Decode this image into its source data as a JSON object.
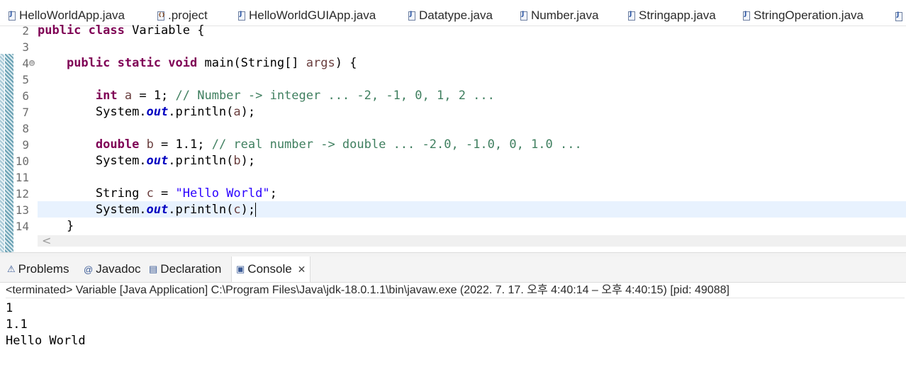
{
  "editor_tabs": [
    {
      "label": "HelloWorldApp.java",
      "icon": "java-file-icon"
    },
    {
      "label": ".project",
      "icon": "xml-file-icon"
    },
    {
      "label": "HelloWorldGUIApp.java",
      "icon": "java-file-icon"
    },
    {
      "label": "Datatype.java",
      "icon": "java-file-icon"
    },
    {
      "label": "Number.java",
      "icon": "java-file-icon"
    },
    {
      "label": "Stringapp.java",
      "icon": "java-file-icon"
    },
    {
      "label": "StringOperation.java",
      "icon": "java-file-icon"
    }
  ],
  "editor": {
    "line_numbers": [
      "2",
      "3",
      "4",
      "5",
      "6",
      "7",
      "8",
      "9",
      "10",
      "11",
      "12",
      "13",
      "14"
    ],
    "code": {
      "l2": {
        "kw1": "public",
        "kw2": "class",
        "rest": " Variable {"
      },
      "l4": {
        "kw1": "public",
        "kw2": "static",
        "kw3": "void",
        "rest1": " main(String[] ",
        "param": "args",
        "rest2": ") {"
      },
      "l6": {
        "kw": "int",
        "var": "a",
        "mid": " = 1; ",
        "comment": "// Number -> integer ... -2, -1, 0, 1, 2 ..."
      },
      "l7": {
        "pre": "System.",
        "field": "out",
        "mid": ".println(",
        "var": "a",
        "post": ");"
      },
      "l9": {
        "kw": "double",
        "var": "b",
        "mid": " = 1.1; ",
        "comment": "// real number -> double ... -2.0, -1.0, 0, 1.0 ..."
      },
      "l10": {
        "pre": "System.",
        "field": "out",
        "mid": ".println(",
        "var": "b",
        "post": ");"
      },
      "l12": {
        "type": "String",
        "var": "c",
        "mid": " = ",
        "str": "\"Hello World\"",
        "post": ";"
      },
      "l13": {
        "pre": "System.",
        "field": "out",
        "mid": ".println(",
        "var": "c",
        "post": ");"
      },
      "l14": {
        "text": "}"
      }
    },
    "fold_glyph": "⊖",
    "scroll_left_glyph": "<"
  },
  "panel": {
    "tabs": [
      {
        "label": "Problems",
        "icon": "problems-icon"
      },
      {
        "label": "Javadoc",
        "icon": "javadoc-icon"
      },
      {
        "label": "Declaration",
        "icon": "declaration-icon"
      },
      {
        "label": "Console",
        "icon": "console-icon",
        "active": true
      }
    ],
    "close_glyph": "✕",
    "console_status": "<terminated> Variable [Java Application] C:\\Program Files\\Java\\jdk-18.0.1.1\\bin\\javaw.exe  (2022. 7. 17. 오후 4:40:14 – 오후 4:40:15) [pid: 49088]",
    "output": [
      "1",
      "1.1",
      "Hello World"
    ]
  },
  "colors": {
    "keyword": "#7f0055",
    "comment": "#3f7f5f",
    "string": "#2a00ff",
    "static_field": "#0000c0",
    "local_var": "#6a3e3e",
    "current_line": "#e8f2fe"
  }
}
